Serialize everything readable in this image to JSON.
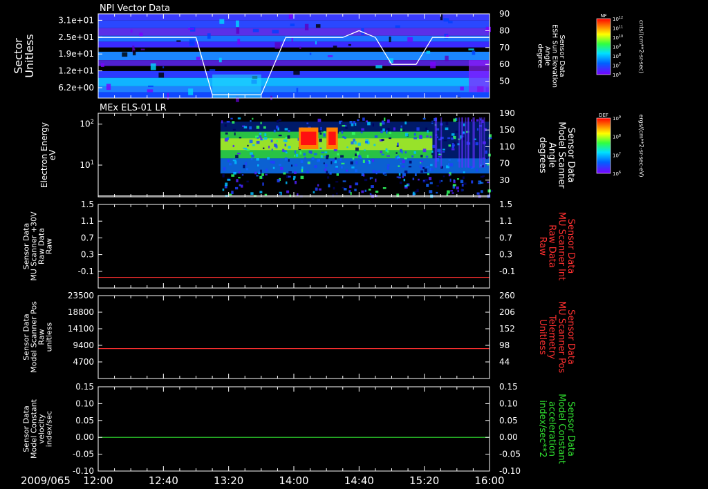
{
  "date_label": "2009/065",
  "time_ticks": [
    "12:00",
    "12:40",
    "13:20",
    "14:00",
    "14:40",
    "15:20",
    "16:00"
  ],
  "panels": [
    {
      "title": "NPI Vector Data",
      "left_label": [
        "Sector",
        "Unitless"
      ],
      "left_ticks": [
        "3.1e+01",
        "2.5e+01",
        "1.9e+01",
        "1.2e+01",
        "6.2e+00"
      ],
      "right_label": [
        "Sensor Data",
        "ESH Sun Elevation",
        "Angle",
        "degree"
      ],
      "right_ticks": [
        "90",
        "80",
        "70",
        "60",
        "50"
      ],
      "colorbar": {
        "title": "NF",
        "ticks": [
          "10^12",
          "10^11",
          "10^10",
          "10^9",
          "10^8",
          "10^7",
          "10^6"
        ],
        "unit": "cnts/(cm**2-sr-sec)"
      }
    },
    {
      "title": "MEx ELS-01 LR",
      "left_label": [
        "Electron Energy",
        "eV"
      ],
      "left_ticks": [
        "10^2",
        "10^1"
      ],
      "right_label": [
        "Sensor Data",
        "Model Scanner",
        "Angle",
        "degrees"
      ],
      "right_ticks": [
        "190",
        "150",
        "110",
        "70",
        "30"
      ],
      "colorbar": {
        "title": "DEF",
        "ticks": [
          "10^9",
          "10^8",
          "10^7",
          "10^6"
        ],
        "unit": "ergs/(cm**2-sr-sec-eV)"
      }
    },
    {
      "title": "",
      "left_label": [
        "Sensor Data",
        "MU Scanner +30V",
        "Raw Data",
        "Raw"
      ],
      "left_ticks": [
        "1.5",
        "1.1",
        "0.7",
        "0.3",
        "-0.1"
      ],
      "right_label": [
        "Sensor Data",
        "MU Scanner Int",
        "Raw Data",
        "Raw"
      ],
      "right_ticks": [
        "1.5",
        "1.1",
        "0.7",
        "0.3",
        "-0.1"
      ]
    },
    {
      "title": "",
      "left_label": [
        "Sensor Data",
        "Model Scanner Pos",
        "Raw",
        "unitless"
      ],
      "left_ticks": [
        "23500",
        "18800",
        "14100",
        "9400",
        "4700"
      ],
      "right_label": [
        "Sensor Data",
        "MU Scanner Pos",
        "Telemetry",
        "Unitless"
      ],
      "right_ticks": [
        "260",
        "206",
        "152",
        "98",
        "44"
      ]
    },
    {
      "title": "",
      "left_label": [
        "Sensor Data",
        "Model Constant",
        "velocity",
        "index/sec"
      ],
      "left_ticks": [
        "0.15",
        "0.10",
        "0.05",
        "0.00",
        "-0.05",
        "-0.10"
      ],
      "right_label": [
        "Sensor Data",
        "Model Constant",
        "acceleration",
        "index/sec**2"
      ],
      "right_ticks": [
        "0.15",
        "0.10",
        "0.05",
        "0.00",
        "-0.05",
        "-0.10"
      ]
    }
  ],
  "chart_data": [
    {
      "type": "heatmap",
      "title": "NPI Vector Data",
      "x_range": [
        "12:00",
        "16:00"
      ],
      "ylabel": "Sector Unitless",
      "ylim": [
        0,
        31
      ],
      "overlay_series": {
        "name": "ESH Sun Elevation Angle",
        "unit": "degree",
        "ylim": [
          40,
          90
        ],
        "x": [
          "12:00",
          "12:30",
          "13:00",
          "13:10",
          "13:40",
          "13:55",
          "14:30",
          "14:40",
          "14:50",
          "15:00",
          "15:05",
          "15:15",
          "15:25",
          "16:00"
        ],
        "y": [
          76,
          76,
          76,
          42,
          42,
          76,
          76,
          80,
          76,
          60,
          60,
          60,
          76,
          76
        ]
      }
    },
    {
      "type": "heatmap",
      "title": "MEx ELS-01 LR",
      "x_range": [
        "12:00",
        "16:00"
      ],
      "ylabel": "Electron Energy eV",
      "data_start": "13:15",
      "high_flux_intervals": [
        [
          "14:03",
          "14:15"
        ],
        [
          "14:20",
          "14:27"
        ]
      ],
      "overlay_series": {
        "name": "Model Scanner Angle",
        "unit": "degrees",
        "ylim": [
          10,
          190
        ],
        "x": [
          "12:00",
          "16:00"
        ],
        "y": [
          12,
          12
        ]
      }
    },
    {
      "type": "line",
      "x_range": [
        "12:00",
        "16:00"
      ],
      "ylim": [
        -0.3,
        1.5
      ],
      "series": [
        {
          "name": "MU Scanner Int Raw Data",
          "color": "#ff3030",
          "x": [
            "12:00",
            "16:00"
          ],
          "y": [
            -0.07,
            -0.07
          ]
        }
      ]
    },
    {
      "type": "line",
      "x_range": [
        "12:00",
        "16:00"
      ],
      "ylim": [
        0,
        23500
      ],
      "series": [
        {
          "name": "MU Scanner Pos Telemetry",
          "color": "#ff3030",
          "x": [
            "12:00",
            "16:00"
          ],
          "y": [
            8500,
            8500
          ]
        }
      ]
    },
    {
      "type": "line",
      "x_range": [
        "12:00",
        "16:00"
      ],
      "ylim": [
        -0.1,
        0.15
      ],
      "series": [
        {
          "name": "Model Constant acceleration",
          "color": "#30e030",
          "x": [
            "12:00",
            "16:00"
          ],
          "y": [
            0.0,
            0.0
          ]
        }
      ]
    }
  ],
  "colors": {
    "axis": "#ffffff",
    "red_label": "#ff3030",
    "green_label": "#30e030",
    "red_line": "#ff3030",
    "green_line": "#30e030"
  }
}
